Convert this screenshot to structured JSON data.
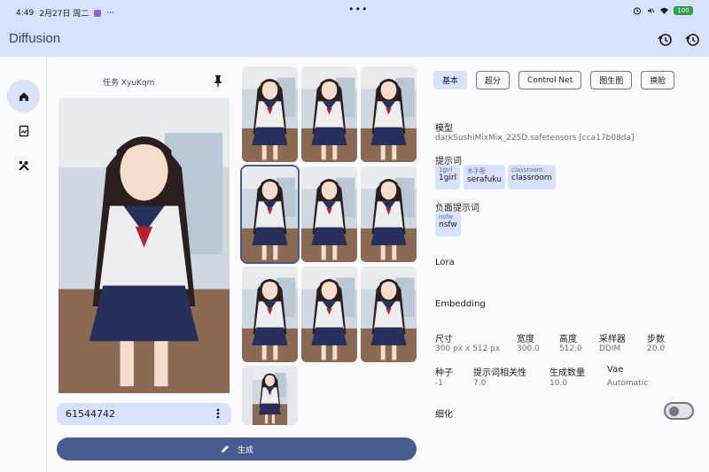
{
  "status_bar": {
    "time": "4:49",
    "date": "2月27日 周二",
    "more": "···",
    "center": "•••",
    "battery": "100"
  },
  "app": {
    "title": "Diffusion"
  },
  "icons": {
    "history1": "history-icon",
    "history2": "history-icon",
    "home": "home-icon",
    "gallery": "gallery-icon",
    "tools": "tools-icon",
    "pin": "pin-icon",
    "more": "more-vert-icon",
    "edit": "edit-icon"
  },
  "task": {
    "label": "任务 XyuKqm"
  },
  "seed_box": {
    "value": "61544742"
  },
  "generate": {
    "label": "生成"
  },
  "tabs": [
    "基本",
    "超分",
    "Control Net",
    "图生图",
    "换脸"
  ],
  "params": {
    "model_label": "模型",
    "model_value": "darkSushiMixMix_225D.safetensors [cca17b08da]",
    "prompt_label": "提示词",
    "prompt_chips": [
      {
        "tag": "1girl",
        "value": "1girl"
      },
      {
        "tag": "水手服",
        "value": "serafuku"
      },
      {
        "tag": "classroom",
        "value": "classroom"
      }
    ],
    "neg_label": "负面提示词",
    "neg_chips": [
      {
        "tag": "nsfw",
        "value": "nsfw"
      }
    ],
    "lora_label": "Lora",
    "embedding_label": "Embedding",
    "row1": [
      {
        "label": "尺寸",
        "value": "300 px x 512 px"
      },
      {
        "label": "宽度",
        "value": "300.0"
      },
      {
        "label": "高度",
        "value": "512.0"
      },
      {
        "label": "采样器",
        "value": "DDIM"
      },
      {
        "label": "步数",
        "value": "20.0"
      }
    ],
    "row2": [
      {
        "label": "种子",
        "value": "-1"
      },
      {
        "label": "提示词相关性",
        "value": "7.0"
      },
      {
        "label": "生成数量",
        "value": "10.0"
      },
      {
        "label": "Vae",
        "value": "Automatic"
      }
    ],
    "refine_label": "细化",
    "refine_on": false
  },
  "colors": {
    "appbar": "#d8e2ff",
    "accent": "#465d8e",
    "chip": "#d8e2ff"
  }
}
